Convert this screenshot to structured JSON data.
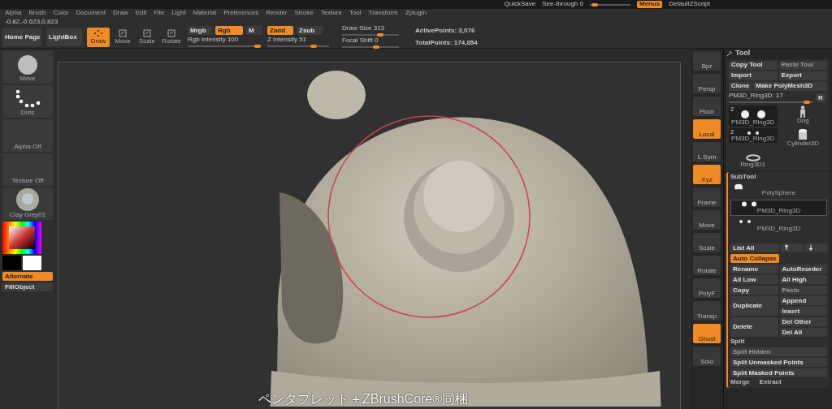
{
  "top_bar": {
    "quicksave": "QuickSave",
    "see_through": {
      "label": "See-through 0",
      "level": 0.05
    },
    "menus": {
      "label": "Menus",
      "selected": true
    },
    "script": "DefaultZScript"
  },
  "menu_bar": [
    "Alpha",
    "Brush",
    "Color",
    "Document",
    "Draw",
    "Edit",
    "File",
    "Light",
    "Material",
    "Preferences",
    "Render",
    "Stroke",
    "Texture",
    "Tool",
    "Transform",
    "Zplugin"
  ],
  "coordinates": "-0.82,-0.623,0.823",
  "toolbar": {
    "home_page": "Home Page",
    "lightbox": "LightBox",
    "tools": [
      {
        "label": "Draw",
        "selected": true
      },
      {
        "label": "Move",
        "selected": false
      },
      {
        "label": "Scale",
        "selected": false
      },
      {
        "label": "Rotate",
        "selected": false
      }
    ],
    "modes_top": [
      {
        "label": "Mrgb",
        "selected": false
      },
      {
        "label": "Rgb",
        "selected": true
      },
      {
        "label": "M",
        "selected": false
      }
    ],
    "modes_z": [
      {
        "label": "Zadd",
        "selected": true
      },
      {
        "label": "Zsub",
        "selected": false
      }
    ],
    "sliders": [
      {
        "label": "Rgb Intensity 100",
        "level": 0.95
      },
      {
        "label": "Z Intensity 51",
        "level": 0.75
      },
      {
        "label": "Draw Size 313",
        "level": 0.67
      },
      {
        "label": "Focal Shift 0",
        "level": 0.6
      }
    ],
    "stats": [
      "ActivePoints: 3,076",
      "TotalPoints: 174,854"
    ]
  },
  "left_shelf": {
    "tiles": [
      {
        "kind": "brush",
        "label": "Move"
      },
      {
        "kind": "stroke",
        "label": "Dots"
      },
      {
        "kind": "empty",
        "label": "Alpha  Off"
      },
      {
        "kind": "empty",
        "label": "Texture  Off"
      },
      {
        "kind": "material",
        "label": "Clay  Grey01"
      }
    ],
    "alternate": {
      "label": "Alternate",
      "selected": true
    },
    "fill_object": "FillObject"
  },
  "right_shelf": [
    {
      "label": "Bpr",
      "active": false
    },
    {
      "label": "Persp",
      "active": false
    },
    {
      "label": "Floor",
      "active": false
    },
    {
      "label": "Local",
      "active": true
    },
    {
      "label": "L.Sym",
      "active": false
    },
    {
      "label": "Xyz",
      "active": true
    },
    {
      "label": "Frame",
      "active": false
    },
    {
      "label": "Move",
      "active": false
    },
    {
      "label": "Scale",
      "active": false
    },
    {
      "label": "Rotate",
      "active": false
    },
    {
      "label": "PolyF",
      "active": false
    },
    {
      "label": "Transp",
      "active": false
    },
    {
      "label": "Ghost",
      "active": true
    },
    {
      "label": "Solo",
      "active": false
    }
  ],
  "tool_panel": {
    "title": "Tool",
    "buttons": [
      {
        "label": "Copy Tool",
        "disabled": false
      },
      {
        "label": "Paste Tool",
        "disabled": true
      },
      {
        "label": "Import",
        "disabled": false
      },
      {
        "label": "Export",
        "disabled": false
      },
      {
        "label": "Clone",
        "disabled": false
      },
      {
        "label": "Make PolyMesh3D",
        "disabled": false
      }
    ],
    "slider": {
      "label": "PM3D_Ring3D: 17",
      "level": 0.92
    },
    "r_button": "R",
    "thumbs": [
      {
        "kind": "spheres",
        "label": "PM3D_Ring3D",
        "count": "2"
      },
      {
        "kind": "figure",
        "label": "Dog"
      },
      {
        "kind": "dots",
        "label": "PM3D_Ring3D",
        "count": "2"
      },
      {
        "kind": "cylinder",
        "label": "Cylinder3D"
      },
      {
        "kind": "ring",
        "label": "Ring3D1"
      }
    ],
    "subtool": {
      "title": "SubTool",
      "items": [
        {
          "kind": "dome",
          "label": "PolySphere",
          "selected": false
        },
        {
          "kind": "spheres",
          "label": "PM3D_Ring3D",
          "selected": true
        },
        {
          "kind": "dots",
          "label": "PM3D_Ring3D",
          "selected": false
        }
      ]
    },
    "list_all": "List All",
    "auto_collapse": {
      "label": "Auto Collapse",
      "selected": true
    },
    "actions": [
      {
        "label": "Rename",
        "disabled": false
      },
      {
        "label": "AutoReorder",
        "disabled": false
      },
      {
        "label": "All Low",
        "disabled": false
      },
      {
        "label": "All High",
        "disabled": false
      },
      {
        "label": "Copy",
        "disabled": false
      },
      {
        "label": "Paste",
        "disabled": true
      }
    ],
    "duplicate": "Duplicate",
    "duplicate_side": [
      "Append",
      "Insert"
    ],
    "delete": "Delete",
    "delete_side": [
      "Del Other",
      "Del All"
    ],
    "split": {
      "title": "Split",
      "items": [
        {
          "label": "Split Hidden",
          "disabled": true
        },
        {
          "label": "Split Unmasked Points",
          "disabled": false
        },
        {
          "label": "Split Masked Points",
          "disabled": false
        }
      ]
    },
    "footer": [
      "Merge",
      "Extract"
    ]
  },
  "subtitle": "ペンタブレット＋ZBrushCore®同梱"
}
